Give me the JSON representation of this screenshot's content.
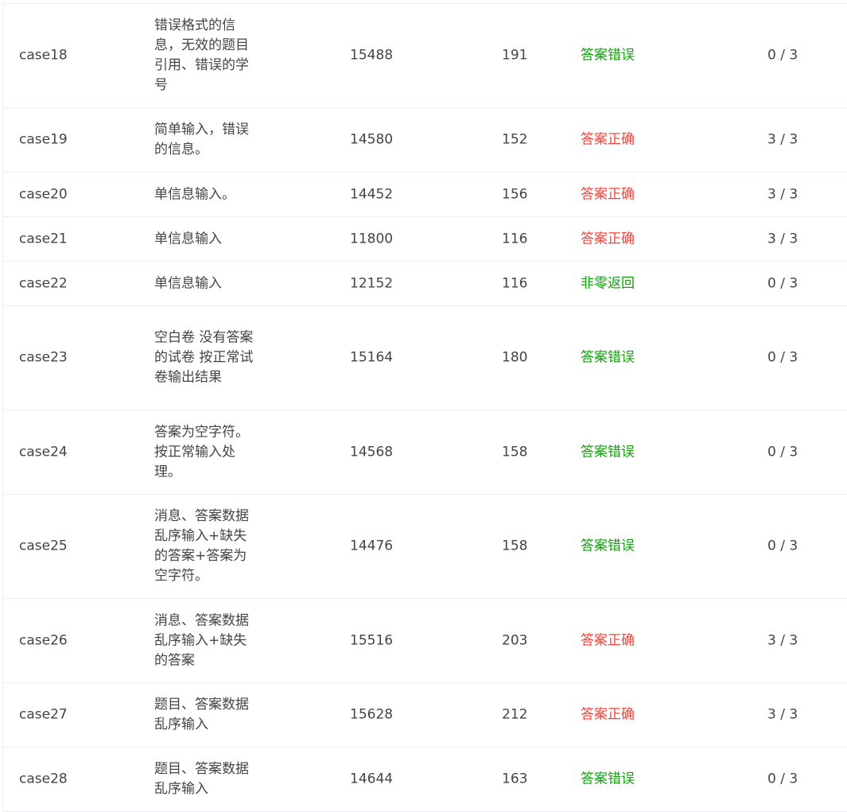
{
  "rows": [
    {
      "name": "case18",
      "desc": "错误格式的信息，无效的题目引用、错误的学号",
      "time": "15488",
      "memory": "191",
      "status": "答案错误",
      "status_kind": "wrong",
      "score": "0 / 3"
    },
    {
      "name": "case19",
      "desc": "简单输入，错误的信息。",
      "time": "14580",
      "memory": "152",
      "status": "答案正确",
      "status_kind": "right",
      "score": "3 / 3"
    },
    {
      "name": "case20",
      "desc": "单信息输入。",
      "time": "14452",
      "memory": "156",
      "status": "答案正确",
      "status_kind": "right",
      "score": "3 / 3"
    },
    {
      "name": "case21",
      "desc": "单信息输入",
      "time": "11800",
      "memory": "116",
      "status": "答案正确",
      "status_kind": "right",
      "score": "3 / 3"
    },
    {
      "name": "case22",
      "desc": "单信息输入",
      "time": "12152",
      "memory": "116",
      "status": "非零返回",
      "status_kind": "wrong",
      "score": "0 / 3"
    },
    {
      "name": "case23",
      "desc": "空白卷 没有答案的试卷 按正常试卷输出结果",
      "time": "15164",
      "memory": "180",
      "status": "答案错误",
      "status_kind": "wrong",
      "score": "0 / 3"
    },
    {
      "name": "case24",
      "desc": "答案为空字符。按正常输入处理。",
      "time": "14568",
      "memory": "158",
      "status": "答案错误",
      "status_kind": "wrong",
      "score": "0 / 3"
    },
    {
      "name": "case25",
      "desc": "消息、答案数据乱序输入+缺失的答案+答案为空字符。",
      "time": "14476",
      "memory": "158",
      "status": "答案错误",
      "status_kind": "wrong",
      "score": "0 / 3"
    },
    {
      "name": "case26",
      "desc": "消息、答案数据乱序输入+缺失的答案",
      "time": "15516",
      "memory": "203",
      "status": "答案正确",
      "status_kind": "right",
      "score": "3 / 3"
    },
    {
      "name": "case27",
      "desc": "题目、答案数据乱序输入",
      "time": "15628",
      "memory": "212",
      "status": "答案正确",
      "status_kind": "right",
      "score": "3 / 3"
    },
    {
      "name": "case28",
      "desc": "题目、答案数据乱序输入",
      "time": "14644",
      "memory": "163",
      "status": "答案错误",
      "status_kind": "wrong",
      "score": "0 / 3"
    }
  ]
}
